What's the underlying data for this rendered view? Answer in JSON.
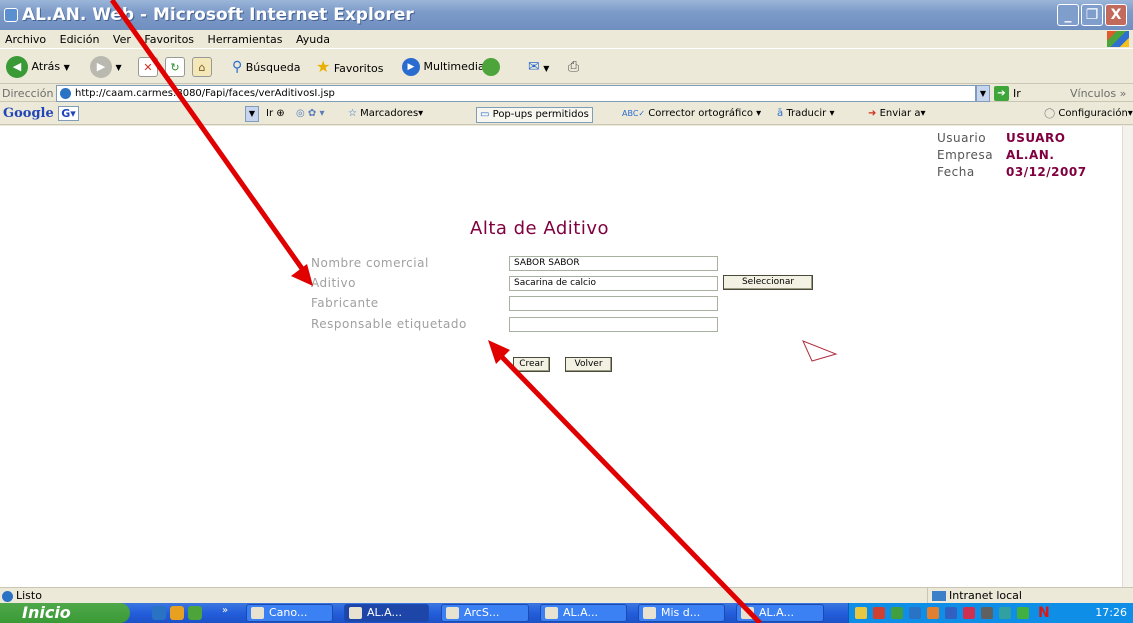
{
  "window": {
    "title": "AL.AN. Web - Microsoft Internet Explorer",
    "buttons": [
      "_",
      "❐",
      "X"
    ]
  },
  "menu": [
    "Archivo",
    "Edición",
    "Ver",
    "Favoritos",
    "Herramientas",
    "Ayuda"
  ],
  "toolbar": {
    "back": "Atrás",
    "search": "Búsqueda",
    "favorites": "Favoritos",
    "media": "Multimedia"
  },
  "address": {
    "label": "Dirección",
    "url": "http://caam.carmes:8080/Fapi/faces/verAditivosI.jsp",
    "go": "Ir",
    "links": "Vínculos"
  },
  "google_bar": {
    "logo": "Google",
    "go": "Ir",
    "bookmarks": "Marcadores",
    "popups": "Pop-ups permitidos",
    "spell": "Corrector ortográfico",
    "translate": "Traducir",
    "send": "Enviar a",
    "settings": "Configuración"
  },
  "user_info": {
    "user_label": "Usuario",
    "user_value": "USUARO",
    "company_label": "Empresa",
    "company_value": "AL.AN.",
    "date_label": "Fecha",
    "date_value": "03/12/2007"
  },
  "form": {
    "title": "Alta de Aditivo",
    "fields": [
      {
        "label": "Nombre comercial",
        "value": "SABOR SABOR"
      },
      {
        "label": "Aditivo",
        "value": "Sacarina de calcio"
      },
      {
        "label": "Fabricante",
        "value": ""
      },
      {
        "label": "Responsable etiquetado",
        "value": ""
      }
    ],
    "select_button": "Seleccionar",
    "create_button": "Crear",
    "back_button": "Volver"
  },
  "status": {
    "text": "Listo",
    "zone": "Intranet local"
  },
  "taskbar": {
    "start": "Inicio",
    "tasks": [
      "Cano...",
      "AL.A...",
      "ArcS...",
      "AL.A...",
      "Mis d...",
      "AL.A..."
    ],
    "tray_letter": "N",
    "clock": "17:26"
  },
  "colors": {
    "accent": "#800040",
    "annotation": "#e00000",
    "label_gray": "#a0a0a0"
  }
}
